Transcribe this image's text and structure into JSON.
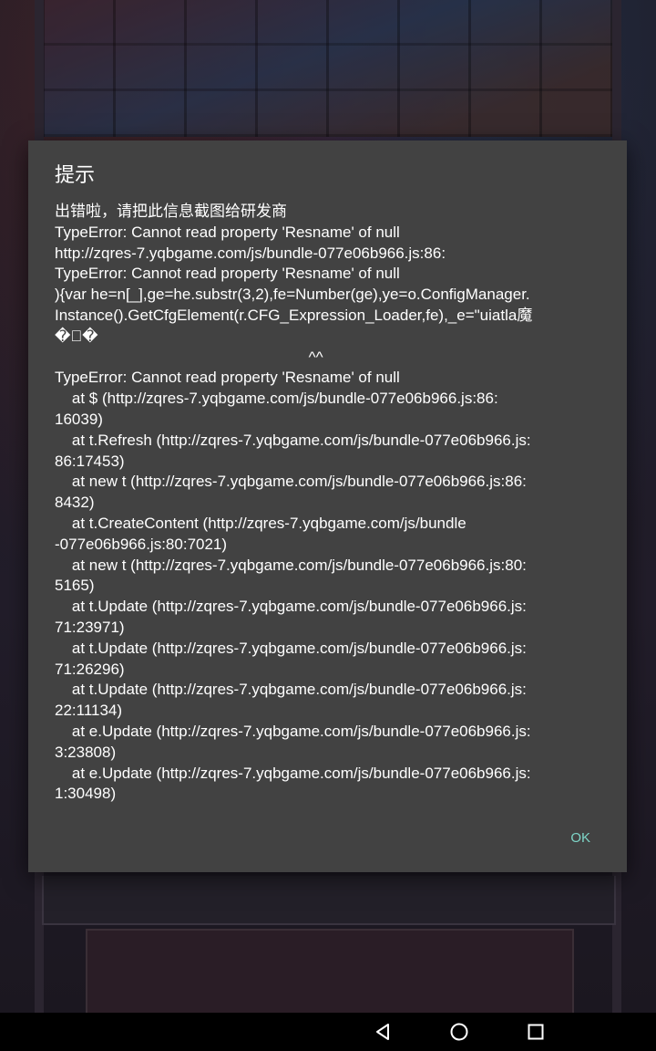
{
  "dialog": {
    "title": "提示",
    "message_lines": [
      "出错啦，请把此信息截图给研发商",
      "TypeError: Cannot read property 'Resname' of null",
      "http://zqres-7.yqbgame.com/js/bundle-077e06b966.js:86:",
      "TypeError: Cannot read property 'Resname' of null",
      "){var he=n[_],ge=he.substr(3,2),fe=Number(ge),ye=o.ConfigManager.",
      "Instance().GetCfgElement(r.CFG_Expression_Loader,fe),_e=\"uiatla魔",
      "�\u0000�",
      "                                                           ^^",
      "TypeError: Cannot read property 'Resname' of null",
      "    at $ (http://zqres-7.yqbgame.com/js/bundle-077e06b966.js:86:",
      "16039)",
      "    at t.Refresh (http://zqres-7.yqbgame.com/js/bundle-077e06b966.js:",
      "86:17453)",
      "    at new t (http://zqres-7.yqbgame.com/js/bundle-077e06b966.js:86:",
      "8432)",
      "    at t.CreateContent (http://zqres-7.yqbgame.com/js/bundle",
      "-077e06b966.js:80:7021)",
      "    at new t (http://zqres-7.yqbgame.com/js/bundle-077e06b966.js:80:",
      "5165)",
      "    at t.Update (http://zqres-7.yqbgame.com/js/bundle-077e06b966.js:",
      "71:23971)",
      "    at t.Update (http://zqres-7.yqbgame.com/js/bundle-077e06b966.js:",
      "71:26296)",
      "    at t.Update (http://zqres-7.yqbgame.com/js/bundle-077e06b966.js:",
      "22:11134)",
      "    at e.Update (http://zqres-7.yqbgame.com/js/bundle-077e06b966.js:",
      "3:23808)",
      "    at e.Update (http://zqres-7.yqbgame.com/js/bundle-077e06b966.js:",
      "1:30498)"
    ],
    "ok_label": "OK",
    "ok_color": "#7ed6c8",
    "background_color": "#424242"
  },
  "navbar": {
    "back_icon": "back-triangle-icon",
    "home_icon": "home-circle-icon",
    "recent_icon": "recent-apps-square-icon"
  }
}
